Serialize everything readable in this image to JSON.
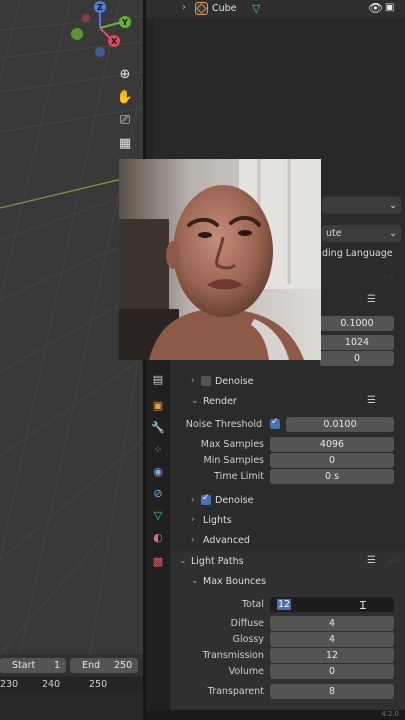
{
  "outliner": {
    "object_name": "Cube"
  },
  "properties": {
    "top_fields": {
      "field1_suffix": "ute",
      "field2_suffix": "ding Language"
    },
    "partial_rows": {
      "v1": "0.1000",
      "v2": "1024",
      "v3": "0"
    },
    "denoise_top_label": "Denoise",
    "render_header": "Render",
    "noise_threshold": {
      "label": "Noise Threshold",
      "value": "0.0100"
    },
    "max_samples": {
      "label": "Max Samples",
      "value": "4096"
    },
    "min_samples": {
      "label": "Min Samples",
      "value": "0"
    },
    "time_limit": {
      "label": "Time Limit",
      "value": "0 s"
    },
    "denoise_label": "Denoise",
    "lights_label": "Lights",
    "advanced_label": "Advanced",
    "light_paths_label": "Light Paths",
    "max_bounces_label": "Max Bounces",
    "bounces": [
      {
        "key": "total",
        "label": "Total",
        "value": "12"
      },
      {
        "key": "diffuse",
        "label": "Diffuse",
        "value": "4"
      },
      {
        "key": "glossy",
        "label": "Glossy",
        "value": "4"
      },
      {
        "key": "transmission",
        "label": "Transmission",
        "value": "12"
      },
      {
        "key": "volume",
        "label": "Volume",
        "value": "0"
      },
      {
        "key": "transparent",
        "label": "Transparent",
        "value": "8"
      }
    ]
  },
  "timeline": {
    "start_label": "Start",
    "start_value": "1",
    "end_label": "End",
    "end_value": "250",
    "ruler": [
      "230",
      "240",
      "250"
    ]
  },
  "gizmo": {
    "z": "Z",
    "y": "Y",
    "x": "X"
  },
  "statusbar": {
    "text": "4.2.0"
  },
  "colors": {
    "accent": "#4772b3",
    "object_orange": "#e8a046",
    "mesh_green": "#2fd38a"
  }
}
